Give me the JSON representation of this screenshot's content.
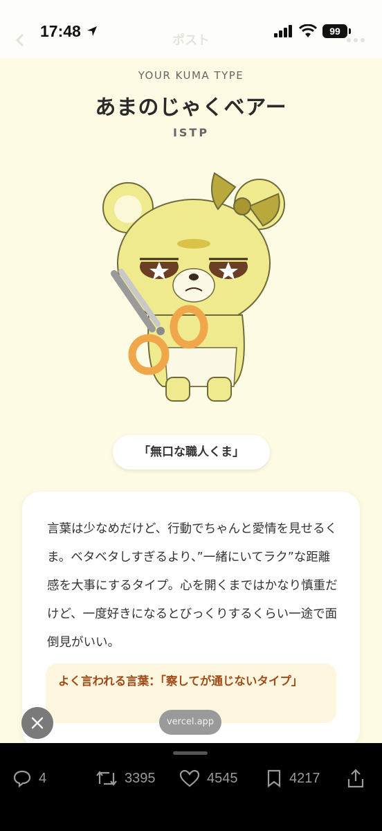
{
  "status_bar": {
    "time": "17:48",
    "battery": "99",
    "icons": [
      "location-arrow-icon",
      "signal-icon",
      "wifi-icon",
      "battery-icon"
    ]
  },
  "header": {
    "faded_title": "ポスト",
    "icons": [
      "back-arrow-icon",
      "more-icon"
    ]
  },
  "result": {
    "label": "YOUR KUMA TYPE",
    "name": "あまのじゃくベアー",
    "mbti": "ISTP",
    "nickname": "「無口な職人くま」",
    "description": "言葉は少なめだけど、行動でちゃんと愛情を見せるくま。ベタベタしすぎるより、”一緒にいてラク”な距離感を大事にするタイプ。心を開くまではかなり慎重だけど、一度好きになるとびっくりするくらい一途で面倒見がいい。",
    "quote": "よく言われる言葉：「察してが通じないタイプ」",
    "colors": {
      "background": "#fdfbe3",
      "bear_body": "#f0ea8e",
      "bow": "#b9a93c",
      "scissors": "#f0a64a",
      "quote_text": "#a14a16"
    }
  },
  "overlay": {
    "domain": "vercel.app",
    "close_icon": "close-icon"
  },
  "actions": {
    "replies": "4",
    "reposts": "3395",
    "likes": "4545",
    "bookmarks": "4217",
    "icons": [
      "reply-icon",
      "repost-icon",
      "like-icon",
      "bookmark-icon",
      "share-icon"
    ]
  }
}
